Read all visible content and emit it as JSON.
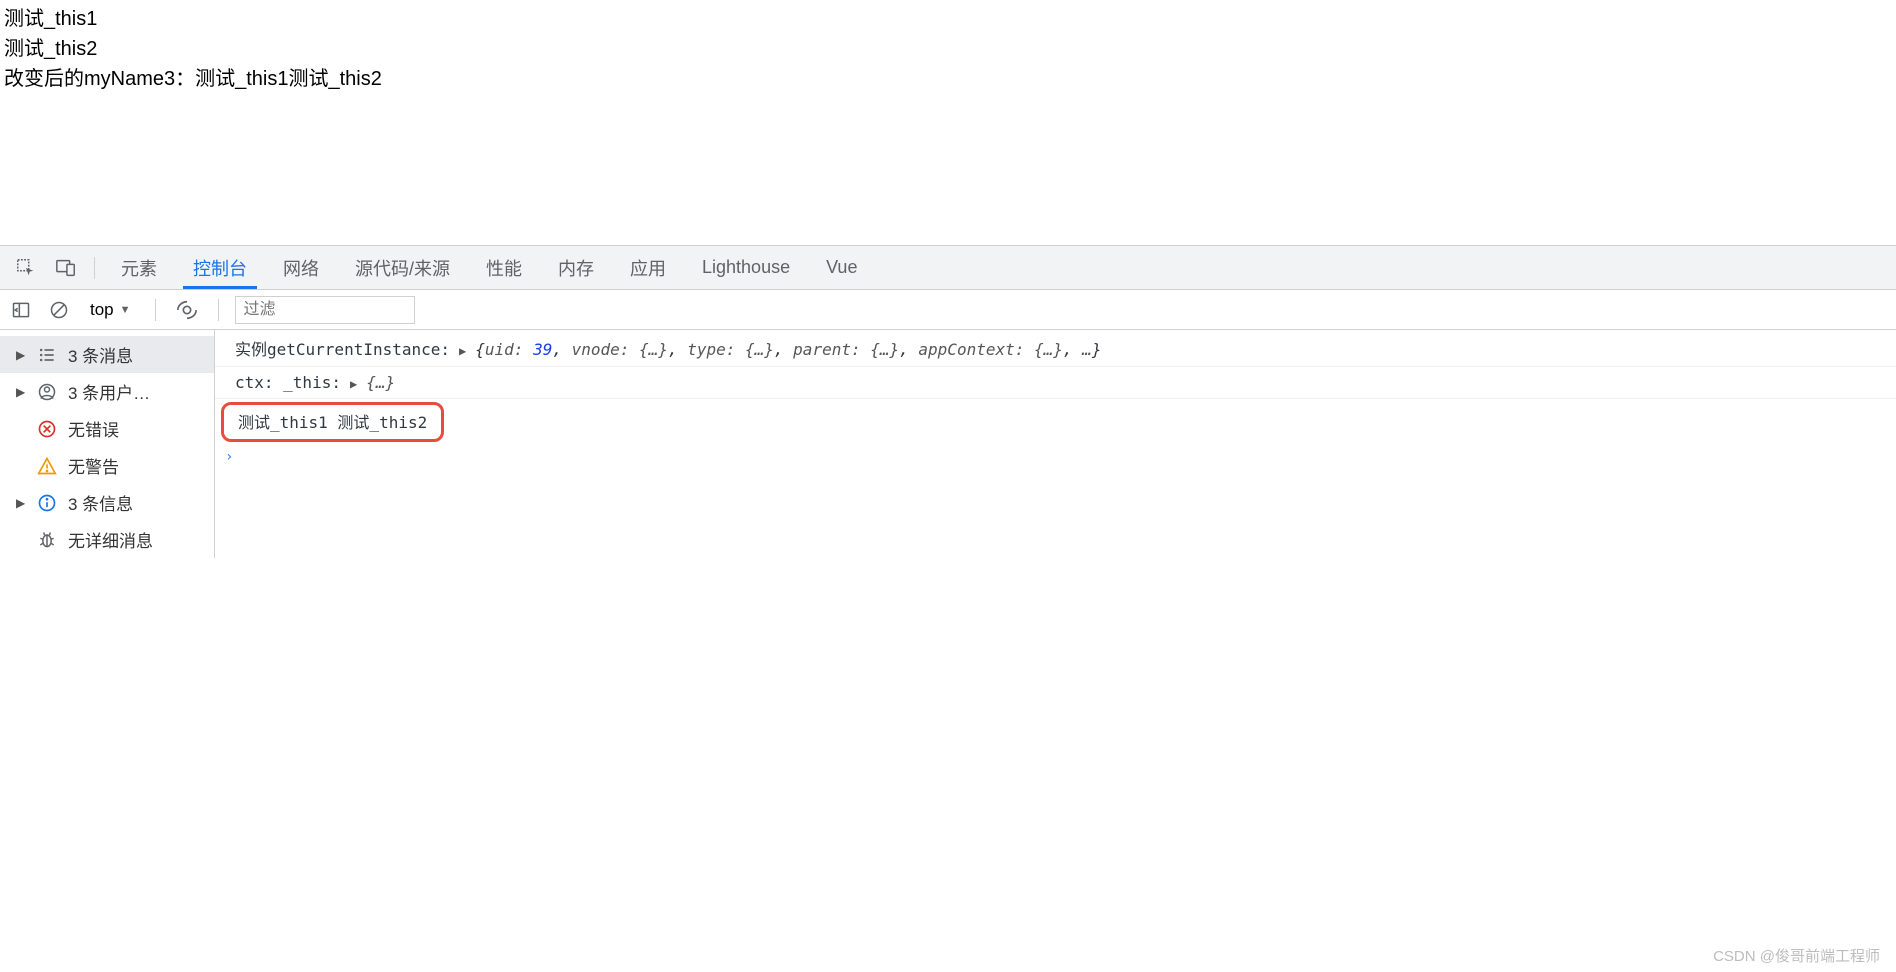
{
  "page_lines": {
    "line1": "测试_this1",
    "line2": "测试_this2",
    "line3": "改变后的myName3：测试_this1测试_this2"
  },
  "devtools": {
    "tabs": {
      "elements": "元素",
      "console": "控制台",
      "network": "网络",
      "sources": "源代码/来源",
      "performance": "性能",
      "memory": "内存",
      "application": "应用",
      "lighthouse": "Lighthouse",
      "vue": "Vue"
    },
    "toolbar": {
      "context": "top",
      "context_caret": "▼",
      "filter_placeholder": "过滤"
    },
    "sidebar": {
      "messages": "3 条消息",
      "users": "3 条用户…",
      "no_errors": "无错误",
      "no_warnings": "无警告",
      "info": "3 条信息",
      "no_verbose": "无详细消息"
    },
    "logs": {
      "row1": {
        "prefix": "实例getCurrentInstance:",
        "uid_key": "uid:",
        "uid_val": "39",
        "vnode": "vnode: {…}",
        "type": "type: {…}",
        "parent": "parent: {…}",
        "appContext": "appContext: {…}",
        "ellipsis": "…"
      },
      "row2": {
        "prefix": "ctx: _this:",
        "obj": "{…}"
      },
      "row3": {
        "text": "测试_this1 测试_this2"
      }
    },
    "prompt_symbol": "›"
  },
  "watermark": "CSDN @俊哥前端工程师"
}
